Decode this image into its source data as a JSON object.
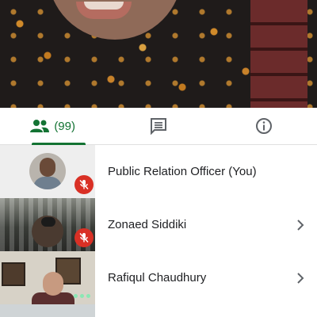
{
  "tabs": {
    "people_count": "(99)",
    "people_icon": "people-icon",
    "chat_icon": "chat-icon",
    "info_icon": "info-icon"
  },
  "participants": [
    {
      "name": "Public Relation Officer (You)",
      "muted": true,
      "has_chevron": false
    },
    {
      "name": "Zonaed Siddiki",
      "muted": true,
      "has_chevron": true
    },
    {
      "name": "Rafiqul Chaudhury",
      "muted": false,
      "has_chevron": true
    }
  ],
  "colors": {
    "accent": "#137333",
    "mic_off": "#d93025",
    "icon_gray": "#5f6368"
  }
}
